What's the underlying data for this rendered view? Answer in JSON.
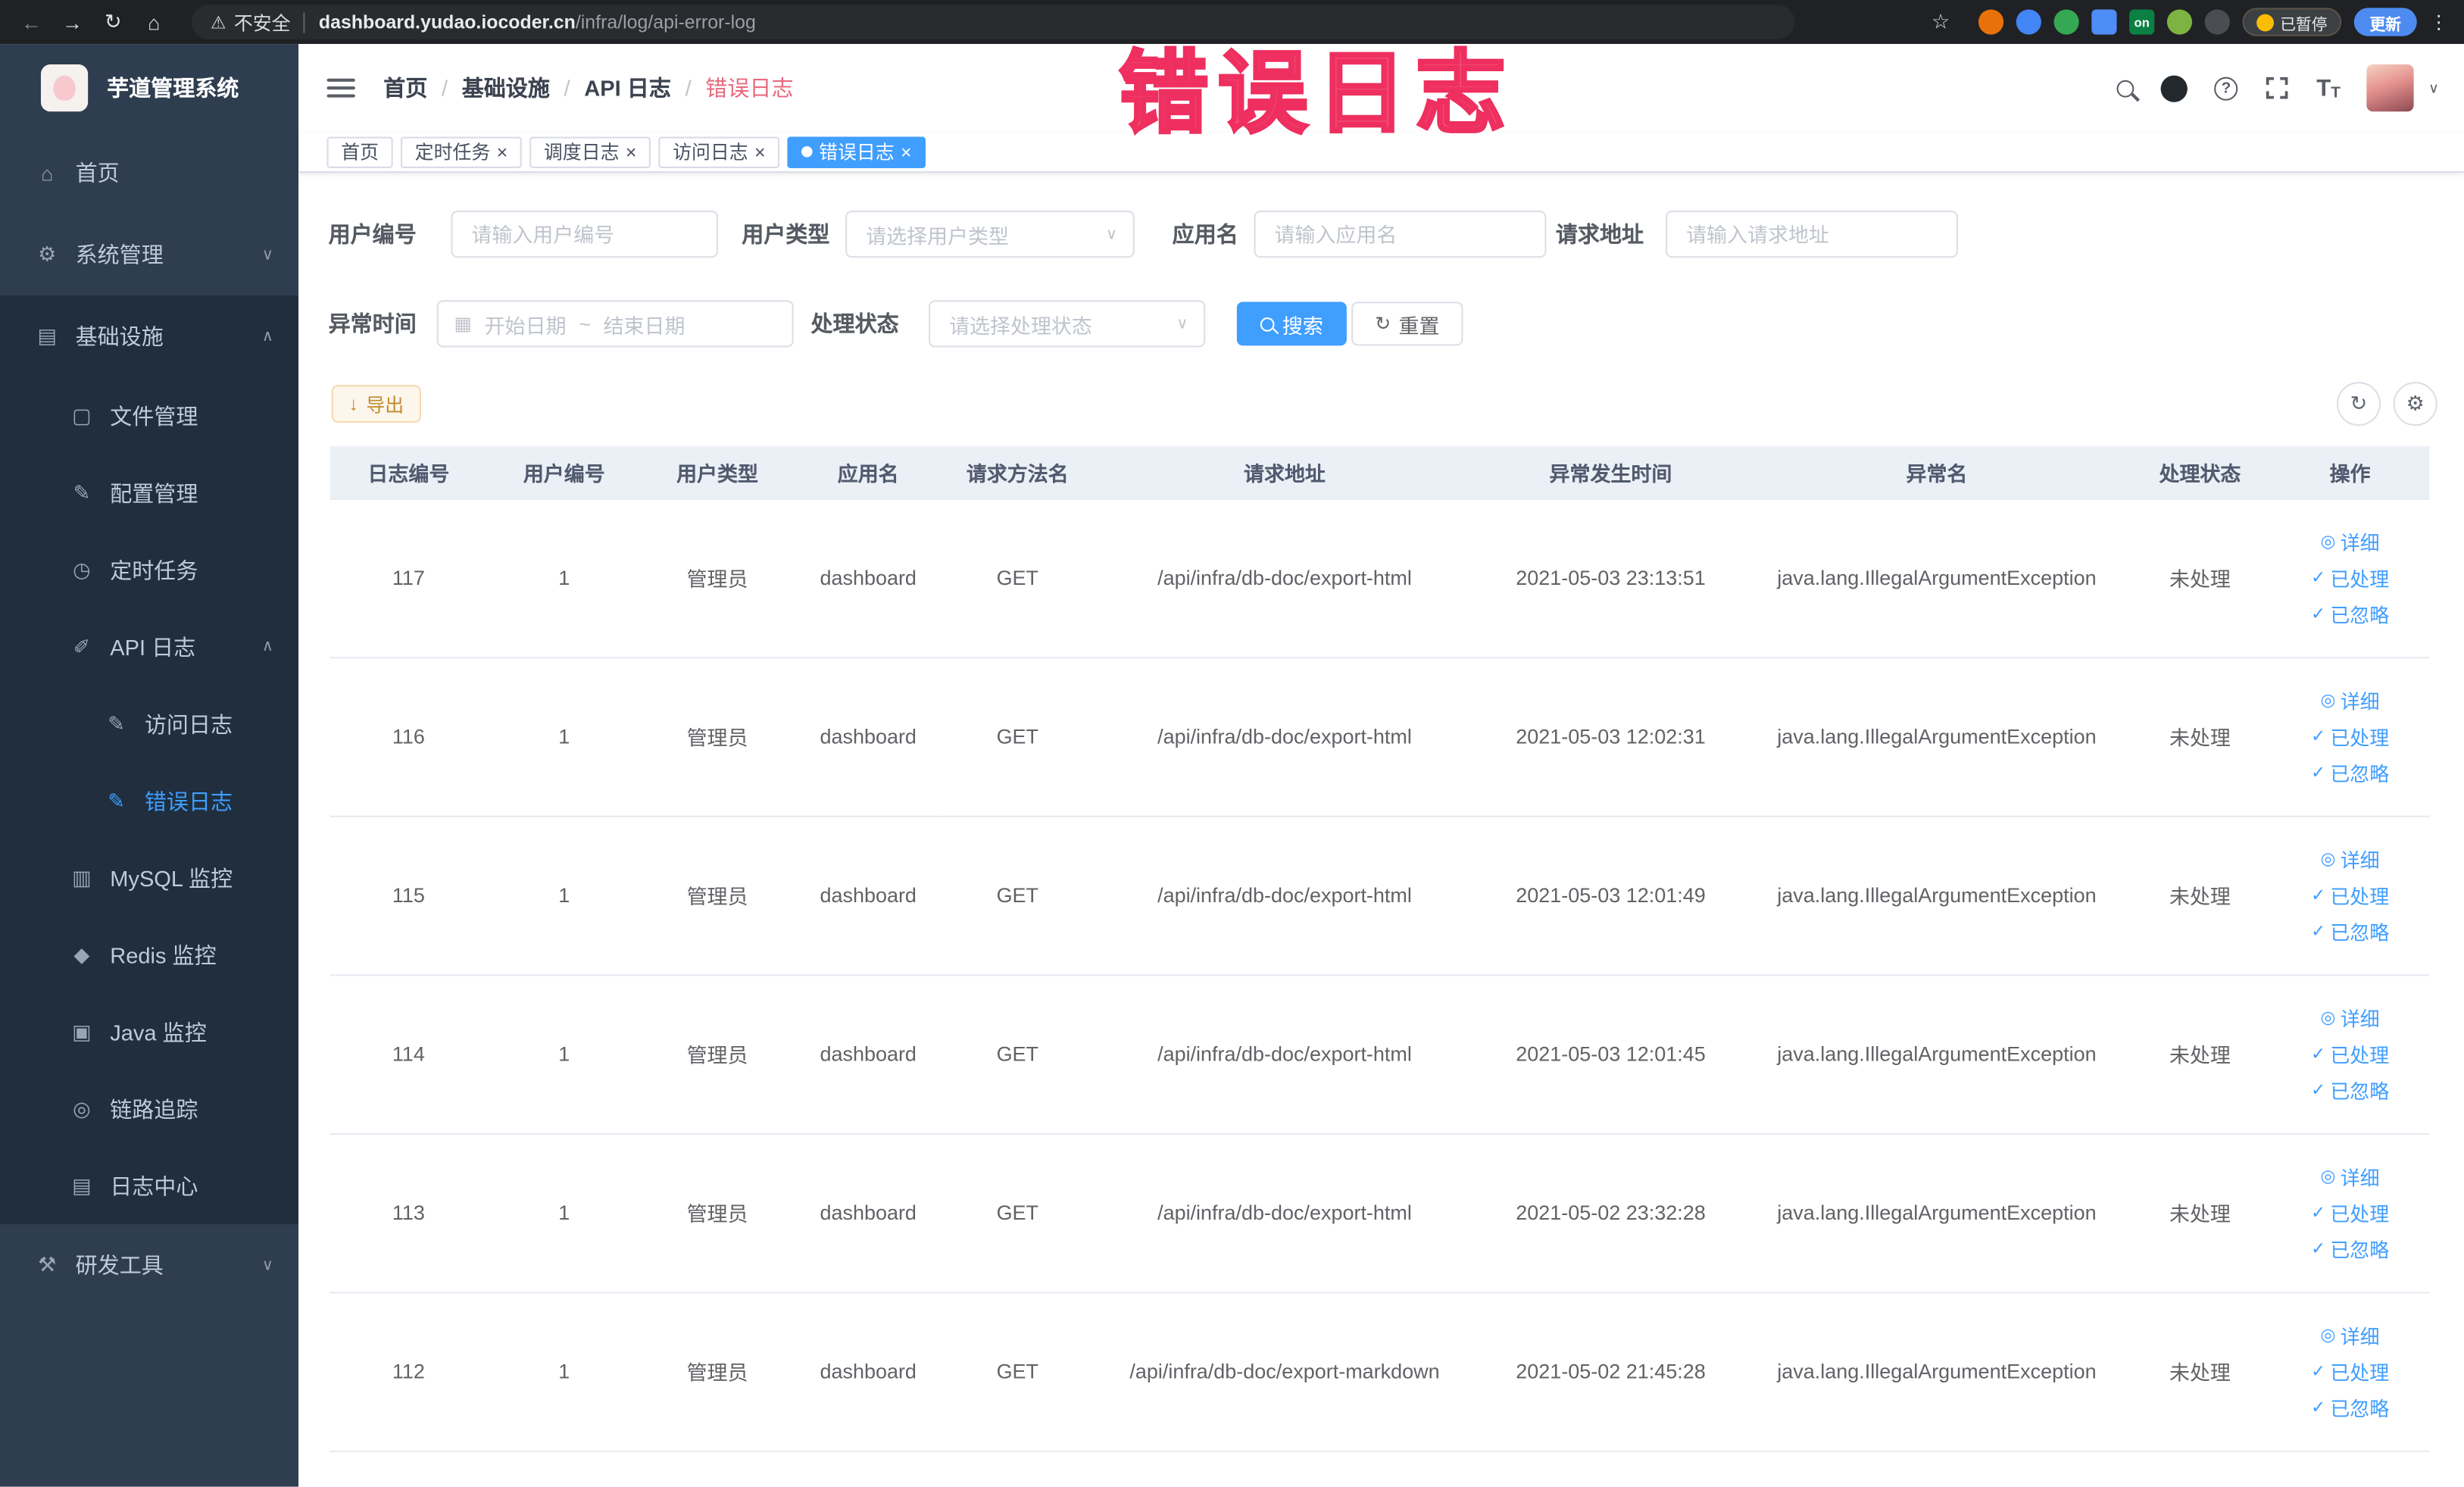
{
  "colors": {
    "accent": "#409eff",
    "annotation": "#f4547a",
    "sidebar_bg": "#2e3d4f",
    "submenu_bg": "#202e3e"
  },
  "browser": {
    "security_label": "不安全",
    "url_host": "dashboard.yudao.iocoder.cn",
    "url_path": "/infra/log/api-error-log",
    "paused_label": "已暂停",
    "update_label": "更新",
    "ext_on_label": "on"
  },
  "sidebar": {
    "app_title": "芋道管理系统",
    "items": [
      {
        "label": "首页"
      },
      {
        "label": "系统管理"
      },
      {
        "label": "基础设施"
      },
      {
        "label": "文件管理"
      },
      {
        "label": "配置管理"
      },
      {
        "label": "定时任务"
      },
      {
        "label": "API 日志"
      },
      {
        "label": "访问日志"
      },
      {
        "label": "错误日志"
      },
      {
        "label": "MySQL 监控"
      },
      {
        "label": "Redis 监控"
      },
      {
        "label": "Java 监控"
      },
      {
        "label": "链路追踪"
      },
      {
        "label": "日志中心"
      },
      {
        "label": "研发工具"
      }
    ]
  },
  "breadcrumb": {
    "items": [
      "首页",
      "基础设施",
      "API 日志",
      "错误日志"
    ],
    "separator": "/"
  },
  "tabs": [
    {
      "label": "首页"
    },
    {
      "label": "定时任务"
    },
    {
      "label": "调度日志"
    },
    {
      "label": "访问日志"
    },
    {
      "label": "错误日志"
    }
  ],
  "filters": {
    "user_id_label": "用户编号",
    "user_id_placeholder": "请输入用户编号",
    "user_type_label": "用户类型",
    "user_type_placeholder": "请选择用户类型",
    "app_name_label": "应用名",
    "app_name_placeholder": "请输入应用名",
    "request_url_label": "请求地址",
    "request_url_placeholder": "请输入请求地址",
    "exception_time_label": "异常时间",
    "date_start_placeholder": "开始日期",
    "date_separator": "~",
    "date_end_placeholder": "结束日期",
    "process_status_label": "处理状态",
    "process_status_placeholder": "请选择处理状态",
    "search_label": "搜索",
    "reset_label": "重置"
  },
  "toolbar": {
    "export_label": "导出"
  },
  "table": {
    "headers": [
      "日志编号",
      "用户编号",
      "用户类型",
      "应用名",
      "请求方法名",
      "请求地址",
      "异常发生时间",
      "异常名",
      "处理状态",
      "操作"
    ],
    "actions": {
      "detail": "详细",
      "process": "已处理",
      "ignore": "已忽略"
    },
    "rows": [
      {
        "id": "117",
        "user_id": "1",
        "user_type": "管理员",
        "app": "dashboard",
        "method": "GET",
        "url": "/api/infra/db-doc/export-html",
        "time": "2021-05-03 23:13:51",
        "exception": "java.lang.IllegalArgumentException",
        "status": "未处理"
      },
      {
        "id": "116",
        "user_id": "1",
        "user_type": "管理员",
        "app": "dashboard",
        "method": "GET",
        "url": "/api/infra/db-doc/export-html",
        "time": "2021-05-03 12:02:31",
        "exception": "java.lang.IllegalArgumentException",
        "status": "未处理"
      },
      {
        "id": "115",
        "user_id": "1",
        "user_type": "管理员",
        "app": "dashboard",
        "method": "GET",
        "url": "/api/infra/db-doc/export-html",
        "time": "2021-05-03 12:01:49",
        "exception": "java.lang.IllegalArgumentException",
        "status": "未处理"
      },
      {
        "id": "114",
        "user_id": "1",
        "user_type": "管理员",
        "app": "dashboard",
        "method": "GET",
        "url": "/api/infra/db-doc/export-html",
        "time": "2021-05-03 12:01:45",
        "exception": "java.lang.IllegalArgumentException",
        "status": "未处理"
      },
      {
        "id": "113",
        "user_id": "1",
        "user_type": "管理员",
        "app": "dashboard",
        "method": "GET",
        "url": "/api/infra/db-doc/export-html",
        "time": "2021-05-02 23:32:28",
        "exception": "java.lang.IllegalArgumentException",
        "status": "未处理"
      },
      {
        "id": "112",
        "user_id": "1",
        "user_type": "管理员",
        "app": "dashboard",
        "method": "GET",
        "url": "/api/infra/db-doc/export-markdown",
        "time": "2021-05-02 21:45:28",
        "exception": "java.lang.IllegalArgumentException",
        "status": "未处理"
      }
    ]
  },
  "annotation": {
    "text": "错误日志"
  },
  "icons": {
    "back": "←",
    "forward": "→",
    "reload": "↻",
    "home": "⌂",
    "warning": "⚠",
    "star": "☆",
    "menu_dots": "⋮",
    "chevron_down": "∨",
    "chevron_up": "∧",
    "close": "×",
    "calendar": "▦",
    "download": "↓",
    "refresh": "↻",
    "gear": "⚙",
    "help": "?",
    "caret_down": "∨",
    "eye": "◎",
    "check": "✓",
    "font_large": "T",
    "font_small": "T",
    "s_home": "⌂",
    "s_system": "⚙",
    "s_infra": "▤",
    "s_file": "▢",
    "s_config": "✎",
    "s_job": "◷",
    "s_apilog": "✐",
    "s_access": "✎",
    "s_error": "✎",
    "s_mysql": "▥",
    "s_redis": "◆",
    "s_java": "▣",
    "s_trace": "◎",
    "s_logcenter": "▤",
    "s_dev": "⚒"
  }
}
